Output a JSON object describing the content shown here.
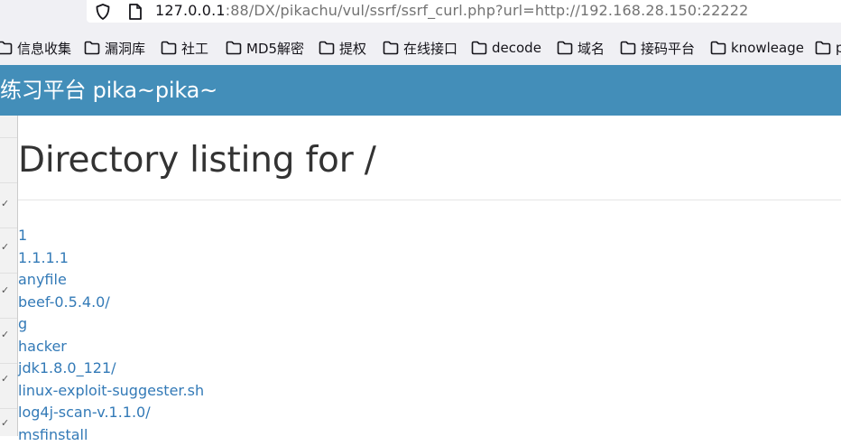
{
  "browser": {
    "url_host": "127.0.0.1",
    "url_rest": ":88/DX/pikachu/vul/ssrf/ssrf_curl.php?url=http://192.168.28.150:22222",
    "bookmarks": [
      {
        "label": "信息收集",
        "icon": "folder-icon"
      },
      {
        "label": "漏洞库",
        "icon": "folder-icon"
      },
      {
        "label": "社工",
        "icon": "folder-icon"
      },
      {
        "label": "MD5解密",
        "icon": "folder-icon"
      },
      {
        "label": "提权",
        "icon": "folder-icon"
      },
      {
        "label": "在线接口",
        "icon": "folder-icon"
      },
      {
        "label": "decode",
        "icon": "folder-icon"
      },
      {
        "label": "域名",
        "icon": "folder-icon"
      },
      {
        "label": "接码平台",
        "icon": "folder-icon"
      },
      {
        "label": "knowleage",
        "icon": "folder-icon"
      },
      {
        "label": "p",
        "icon": "folder-icon"
      }
    ]
  },
  "site": {
    "title": "练习平台 pika~pika~",
    "header_color": "#438eb9"
  },
  "main": {
    "heading": "Directory listing for /",
    "entries": [
      "1",
      "1.1.1.1",
      "anyfile",
      "beef-0.5.4.0/",
      "g",
      "hacker",
      "jdk1.8.0_121/",
      "linux-exploit-suggester.sh",
      "log4j-scan-v.1.1.0/",
      "msfinstall"
    ],
    "link_color": "#337ab7"
  }
}
